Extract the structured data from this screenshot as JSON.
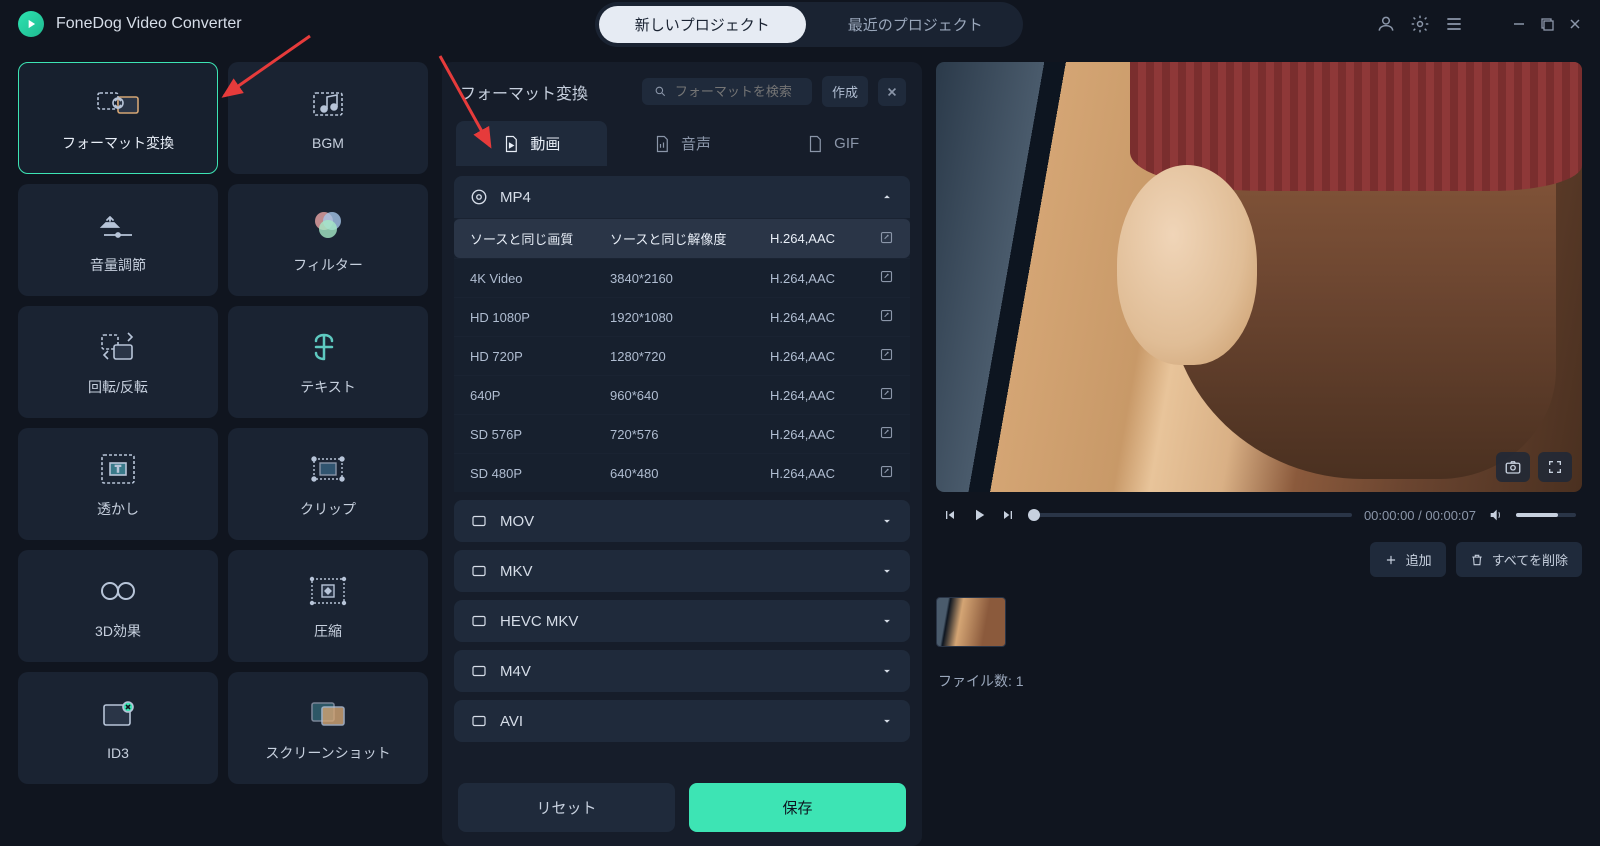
{
  "app": {
    "title": "FoneDog Video Converter"
  },
  "titlebar": {
    "new_project": "新しいプロジェクト",
    "recent_project": "最近のプロジェクト"
  },
  "sidebar": {
    "tools": [
      {
        "label": "フォーマット変換",
        "icon": "format-convert",
        "active": true
      },
      {
        "label": "BGM",
        "icon": "bgm"
      },
      {
        "label": "音量調節",
        "icon": "volume-adjust"
      },
      {
        "label": "フィルター",
        "icon": "filter"
      },
      {
        "label": "回転/反転",
        "icon": "rotate-flip"
      },
      {
        "label": "テキスト",
        "icon": "text"
      },
      {
        "label": "透かし",
        "icon": "watermark"
      },
      {
        "label": "クリップ",
        "icon": "clip"
      },
      {
        "label": "3D効果",
        "icon": "3d-effect"
      },
      {
        "label": "圧縮",
        "icon": "compress"
      },
      {
        "label": "ID3",
        "icon": "id3"
      },
      {
        "label": "スクリーンショット",
        "icon": "screenshot"
      }
    ]
  },
  "center": {
    "title": "フォーマット変換",
    "search_placeholder": "フォーマットを検索",
    "create": "作成",
    "tabs": {
      "video": "動画",
      "audio": "音声",
      "gif": "GIF"
    },
    "expanded_format": "MP4",
    "expanded_rows": [
      {
        "quality": "ソースと同じ画質",
        "resolution": "ソースと同じ解像度",
        "codec": "H.264,AAC",
        "selected": true
      },
      {
        "quality": "4K Video",
        "resolution": "3840*2160",
        "codec": "H.264,AAC"
      },
      {
        "quality": "HD 1080P",
        "resolution": "1920*1080",
        "codec": "H.264,AAC"
      },
      {
        "quality": "HD 720P",
        "resolution": "1280*720",
        "codec": "H.264,AAC"
      },
      {
        "quality": "640P",
        "resolution": "960*640",
        "codec": "H.264,AAC"
      },
      {
        "quality": "SD 576P",
        "resolution": "720*576",
        "codec": "H.264,AAC"
      },
      {
        "quality": "SD 480P",
        "resolution": "640*480",
        "codec": "H.264,AAC"
      }
    ],
    "collapsed_formats": [
      "MOV",
      "MKV",
      "HEVC MKV",
      "M4V",
      "AVI"
    ],
    "reset": "リセット",
    "save": "保存"
  },
  "right": {
    "time_current": "00:00:00",
    "time_total": "00:00:07",
    "add": "追加",
    "delete_all": "すべてを削除",
    "file_count_label": "ファイル数:",
    "file_count_value": "1"
  }
}
